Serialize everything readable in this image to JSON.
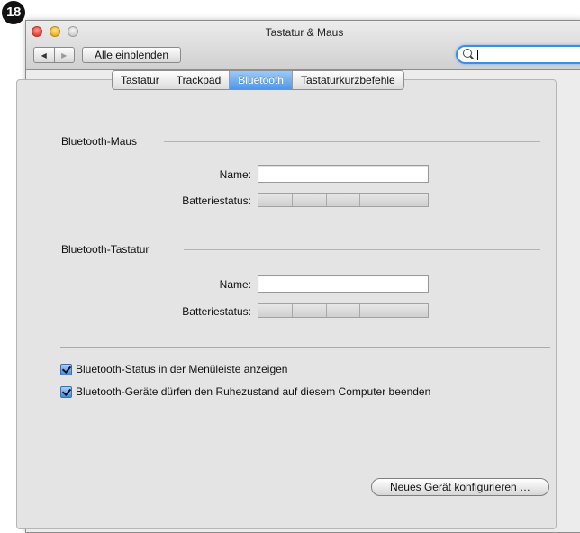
{
  "step_badge": "18",
  "window": {
    "title": "Tastatur & Maus"
  },
  "toolbar": {
    "back_glyph": "◀",
    "forward_glyph": "▶",
    "show_all_label": "Alle einblenden",
    "search": {
      "value": "",
      "icon": "search-icon"
    }
  },
  "tabs": [
    {
      "label": "Tastatur",
      "active": false
    },
    {
      "label": "Trackpad",
      "active": false
    },
    {
      "label": "Bluetooth",
      "active": true
    },
    {
      "label": "Tastaturkurzbefehle",
      "active": false
    }
  ],
  "mouse_section": {
    "title": "Bluetooth-Maus",
    "name_label": "Name:",
    "name_value": "",
    "battery_label": "Batteriestatus:",
    "battery_segments": 5,
    "battery_level": 0
  },
  "keyboard_section": {
    "title": "Bluetooth-Tastatur",
    "name_label": "Name:",
    "name_value": "",
    "battery_label": "Batteriestatus:",
    "battery_segments": 5,
    "battery_level": 0
  },
  "options": [
    {
      "label": "Bluetooth-Status in der Menüleiste anzeigen",
      "checked": true
    },
    {
      "label": "Bluetooth-Geräte dürfen den Ruhezustand auf diesem Computer beenden",
      "checked": true
    }
  ],
  "config_button_label": "Neues Gerät konfigurieren …",
  "colors": {
    "accent": "#4f97ea",
    "window_bg": "#ececec",
    "close": "#e0423a",
    "minimize": "#e8b32c",
    "zoom": "#cfcfcf"
  }
}
